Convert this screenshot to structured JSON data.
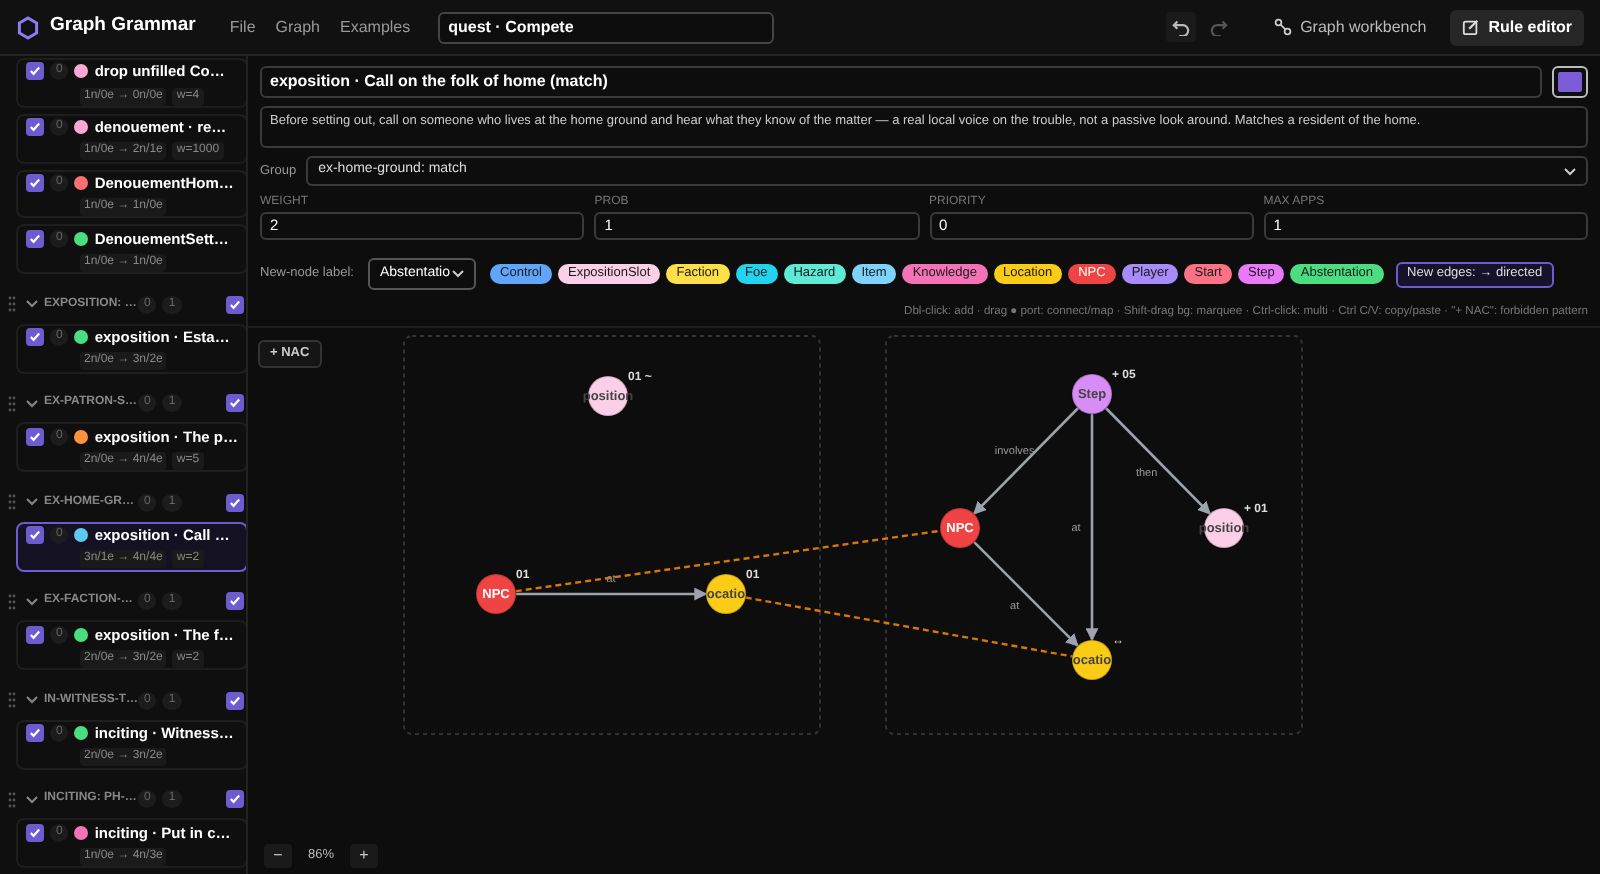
{
  "app": {
    "title": "Graph Grammar",
    "menu": [
      "File",
      "Graph",
      "Examples"
    ],
    "grammar_name": "quest · Compete"
  },
  "toolbar": {
    "buttons": [
      {
        "label": "Graph workbench",
        "selected": false
      },
      {
        "label": "Rule editor",
        "selected": true
      }
    ]
  },
  "sidebar": {
    "entries": [
      {
        "kind": "rule",
        "checked": true,
        "count": "0",
        "color": "#f9a8d4",
        "title": "drop unfilled Co…",
        "stats": "1n/0e → 0n/0e",
        "weight": "w=4",
        "selected": false
      },
      {
        "kind": "rule",
        "checked": true,
        "count": "0",
        "color": "#f9a8d4",
        "title": "denouement · re…",
        "stats": "1n/0e → 2n/1e",
        "weight": "w=1000",
        "selected": false
      },
      {
        "kind": "rule",
        "checked": true,
        "count": "0",
        "color": "#f87171",
        "title": "DenouementHom…",
        "stats": "1n/0e → 1n/0e",
        "selected": false
      },
      {
        "kind": "rule",
        "checked": true,
        "count": "0",
        "color": "#4ade80",
        "title": "DenouementSett…",
        "stats": "1n/0e → 1n/0e",
        "selected": false
      },
      {
        "kind": "group",
        "name": "EXPOSITION: …",
        "count_a": "0",
        "count_b": "1",
        "checked": true
      },
      {
        "kind": "rule",
        "checked": true,
        "count": "0",
        "color": "#4ade80",
        "title": "exposition · Esta…",
        "stats": "2n/0e → 3n/2e",
        "selected": false
      },
      {
        "kind": "group",
        "name": "EX-PATRON-S…",
        "count_a": "0",
        "count_b": "1",
        "checked": true
      },
      {
        "kind": "rule",
        "checked": true,
        "count": "0",
        "color": "#fb923c",
        "title": "exposition · The p…",
        "stats": "2n/0e → 4n/4e",
        "weight": "w=5",
        "selected": false
      },
      {
        "kind": "group",
        "name": "EX-HOME-GR…",
        "count_a": "0",
        "count_b": "1",
        "checked": true
      },
      {
        "kind": "rule",
        "checked": true,
        "count": "0",
        "color": "#5ec8f0",
        "title": "exposition · Call …",
        "stats": "3n/1e → 4n/4e",
        "weight": "w=2",
        "selected": true
      },
      {
        "kind": "group",
        "name": "EX-FACTION-…",
        "count_a": "0",
        "count_b": "1",
        "checked": true
      },
      {
        "kind": "rule",
        "checked": true,
        "count": "0",
        "color": "#4ade80",
        "title": "exposition · The f…",
        "stats": "2n/0e → 3n/2e",
        "weight": "w=2",
        "selected": false
      },
      {
        "kind": "group",
        "name": "IN-WITNESS-T…",
        "count_a": "0",
        "count_b": "1",
        "checked": true
      },
      {
        "kind": "rule",
        "checked": true,
        "count": "0",
        "color": "#4ade80",
        "title": "inciting · Witness…",
        "stats": "2n/0e → 3n/2e",
        "selected": false
      },
      {
        "kind": "group",
        "name": "INCITING: PH-…",
        "count_a": "0",
        "count_b": "1",
        "checked": true
      },
      {
        "kind": "rule",
        "checked": true,
        "count": "0",
        "color": "#f472b6",
        "title": "inciting · Put in c…",
        "stats": "1n/0e → 4n/3e",
        "selected": false
      }
    ]
  },
  "rule": {
    "title": "exposition · Call on the folk of home (match)",
    "color": "#7c5cd6",
    "description": "Before setting out, call on someone who lives at the home ground and hear what they know of the matter — a real local voice on the trouble, not a passive look around. Matches a resident of the home.",
    "group_label": "Group",
    "group": "ex-home-ground: match",
    "params": [
      {
        "label": "WEIGHT",
        "value": "2"
      },
      {
        "label": "PROB",
        "value": "1"
      },
      {
        "label": "PRIORITY",
        "value": "0"
      },
      {
        "label": "MAX APPS",
        "value": "1"
      }
    ],
    "new_node_label": {
      "label": "New-node label:",
      "value": "Abstentatio"
    },
    "labels": [
      {
        "name": "Control",
        "color": "#60a5fa"
      },
      {
        "name": "ExpositionSlot",
        "color": "#fbcfe8"
      },
      {
        "name": "Faction",
        "color": "#fde047"
      },
      {
        "name": "Foe",
        "color": "#22d3ee"
      },
      {
        "name": "Hazard",
        "color": "#5eead4"
      },
      {
        "name": "Item",
        "color": "#7dd3fc"
      },
      {
        "name": "Knowledge",
        "color": "#f472b6"
      },
      {
        "name": "Location",
        "color": "#facc15"
      },
      {
        "name": "NPC",
        "color": "#ef4444"
      },
      {
        "name": "Player",
        "color": "#a78bfa"
      },
      {
        "name": "Start",
        "color": "#fb7185"
      },
      {
        "name": "Step",
        "color": "#e879f9"
      },
      {
        "name": "Abstentation",
        "color": "#4ade80"
      }
    ],
    "edge_mode": {
      "prefix": "New edges:",
      "arrow": "→",
      "value": "directed"
    },
    "hint": "Dbl-click: add · drag ● port: connect/map · Shift-drag bg: marquee · Ctrl-click: multi · Ctrl C/V: copy/paste · \"+ NAC\": forbidden pattern"
  },
  "canvas": {
    "nac_button": "+ NAC",
    "nodes": [
      {
        "label": "position",
        "color": "#fbcfe8",
        "badge": "01 ~"
      },
      {
        "label": "NPC",
        "color": "#ef4444",
        "badge": "01"
      },
      {
        "label": "ocatio",
        "color": "#facc15",
        "badge": "01"
      },
      {
        "label": "Step",
        "color": "#d88cf5",
        "badge": "+ 05"
      },
      {
        "label": "NPC",
        "color": "#ef4444"
      },
      {
        "label": "position",
        "color": "#fbcfe8",
        "badge": "+ 01"
      },
      {
        "label": "ocatio",
        "color": "#facc15",
        "badge": "↔"
      }
    ],
    "edges": [
      {
        "kind": "rule",
        "label": "at"
      },
      {
        "kind": "rule",
        "label": "involves"
      },
      {
        "kind": "rule",
        "label": "then"
      },
      {
        "kind": "rule",
        "label": "at"
      },
      {
        "kind": "rule",
        "label": "at"
      },
      {
        "kind": "mapping"
      },
      {
        "kind": "mapping"
      }
    ],
    "zoom": {
      "minus": "−",
      "level": "86%",
      "plus": "+"
    }
  }
}
